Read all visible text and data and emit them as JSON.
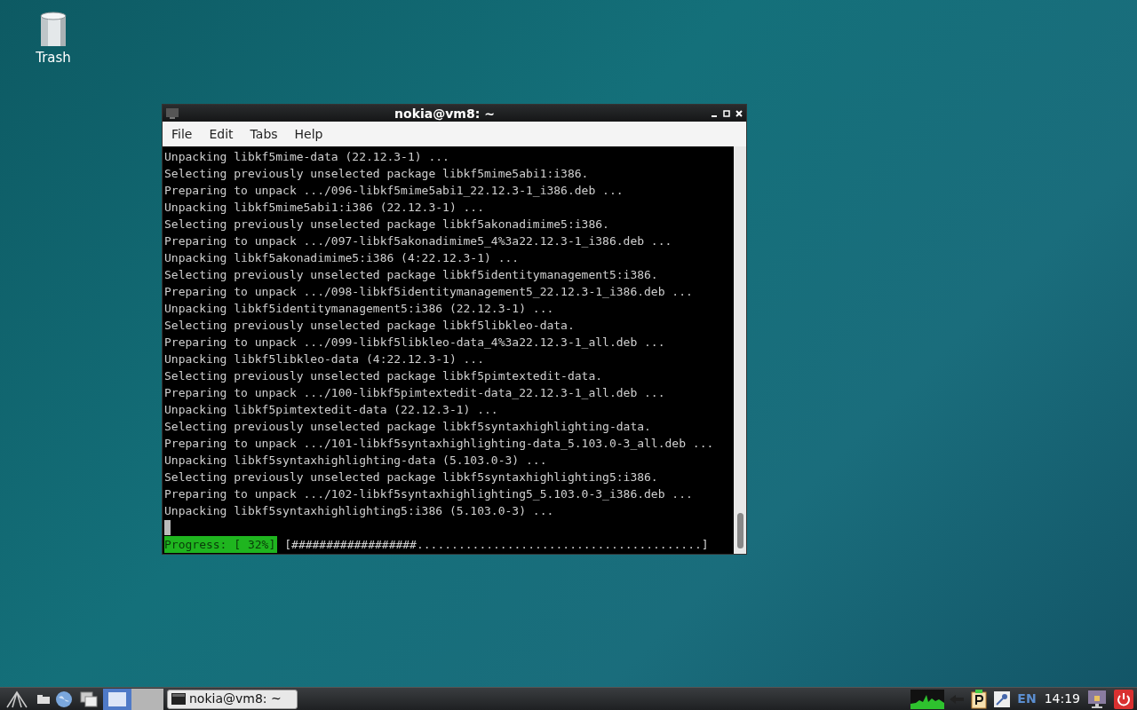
{
  "desktop_icons": [
    {
      "label": "Trash"
    }
  ],
  "window": {
    "title": "nokia@vm8: ~",
    "menu": [
      "File",
      "Edit",
      "Tabs",
      "Help"
    ],
    "terminal_lines": [
      "Unpacking libkf5mime-data (22.12.3-1) ...",
      "Selecting previously unselected package libkf5mime5abi1:i386.",
      "Preparing to unpack .../096-libkf5mime5abi1_22.12.3-1_i386.deb ...",
      "Unpacking libkf5mime5abi1:i386 (22.12.3-1) ...",
      "Selecting previously unselected package libkf5akonadimime5:i386.",
      "Preparing to unpack .../097-libkf5akonadimime5_4%3a22.12.3-1_i386.deb ...",
      "Unpacking libkf5akonadimime5:i386 (4:22.12.3-1) ...",
      "Selecting previously unselected package libkf5identitymanagement5:i386.",
      "Preparing to unpack .../098-libkf5identitymanagement5_22.12.3-1_i386.deb ...",
      "Unpacking libkf5identitymanagement5:i386 (22.12.3-1) ...",
      "Selecting previously unselected package libkf5libkleo-data.",
      "Preparing to unpack .../099-libkf5libkleo-data_4%3a22.12.3-1_all.deb ...",
      "Unpacking libkf5libkleo-data (4:22.12.3-1) ...",
      "Selecting previously unselected package libkf5pimtextedit-data.",
      "Preparing to unpack .../100-libkf5pimtextedit-data_22.12.3-1_all.deb ...",
      "Unpacking libkf5pimtextedit-data (22.12.3-1) ...",
      "Selecting previously unselected package libkf5syntaxhighlighting-data.",
      "Preparing to unpack .../101-libkf5syntaxhighlighting-data_5.103.0-3_all.deb ...",
      "Unpacking libkf5syntaxhighlighting-data (5.103.0-3) ...",
      "Selecting previously unselected package libkf5syntaxhighlighting5:i386.",
      "Preparing to unpack .../102-libkf5syntaxhighlighting5_5.103.0-3_i386.deb ...",
      "Unpacking libkf5syntaxhighlighting5:i386 (5.103.0-3) ..."
    ],
    "progress": {
      "label": "Progress: [ 32%]",
      "bar": "[##################.........................................]"
    }
  },
  "taskbar": {
    "tasks": [
      {
        "label": "nokia@vm8: ~"
      }
    ],
    "language": "EN",
    "clock": "14:19"
  }
}
